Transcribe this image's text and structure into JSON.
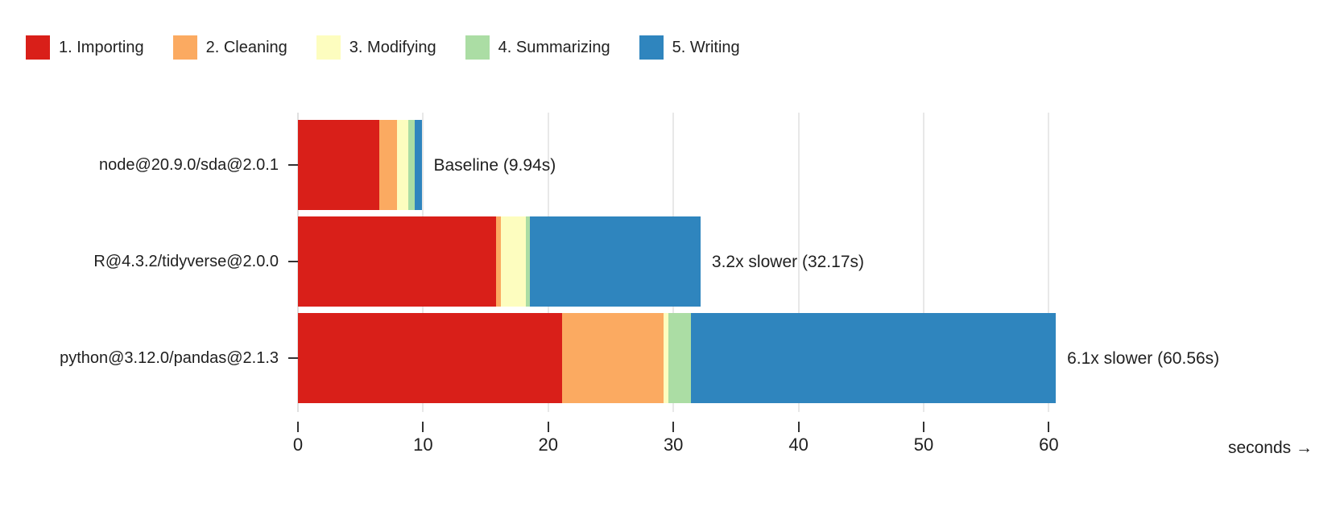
{
  "chart_data": {
    "type": "bar",
    "orientation": "horizontal",
    "stacked": true,
    "title": "",
    "xlabel": "seconds →",
    "ylabel": "",
    "xlim": [
      0,
      63
    ],
    "grid": true,
    "legend_position": "top-left",
    "xticks": [
      0,
      10,
      20,
      30,
      40,
      50,
      60
    ],
    "xtick_labels": [
      "0",
      "10",
      "20",
      "30",
      "40",
      "50",
      "60"
    ],
    "categories": [
      "node@20.9.0/sda@2.0.1",
      "R@4.3.2/tidyverse@2.0.0",
      "python@3.12.0/pandas@2.1.3"
    ],
    "series": [
      {
        "name": "1. Importing",
        "color": "#d91f19",
        "values": [
          6.48,
          15.83,
          21.1
        ]
      },
      {
        "name": "2. Cleaning",
        "color": "#fbaa61",
        "values": [
          1.46,
          0.39,
          8.1
        ]
      },
      {
        "name": "3. Modifying",
        "color": "#fdfdbf",
        "values": [
          0.9,
          2.0,
          0.4
        ]
      },
      {
        "name": "4. Summarizing",
        "color": "#abdda4",
        "values": [
          0.51,
          0.32,
          1.8
        ]
      },
      {
        "name": "5. Writing",
        "color": "#2f85be",
        "values": [
          0.59,
          13.63,
          29.16
        ]
      }
    ],
    "totals": [
      9.94,
      32.17,
      60.56
    ],
    "annotations": [
      "Baseline (9.94s)",
      "3.2x slower (32.17s)",
      "6.1x slower (60.56s)"
    ]
  },
  "legend": {
    "items": [
      {
        "label": "1. Importing",
        "color": "#d91f19"
      },
      {
        "label": "2. Cleaning",
        "color": "#fbaa61"
      },
      {
        "label": "3. Modifying",
        "color": "#fdfdbf"
      },
      {
        "label": "4. Summarizing",
        "color": "#abdda4"
      },
      {
        "label": "5. Writing",
        "color": "#2f85be"
      }
    ]
  },
  "axis": {
    "x_title": "seconds →"
  }
}
